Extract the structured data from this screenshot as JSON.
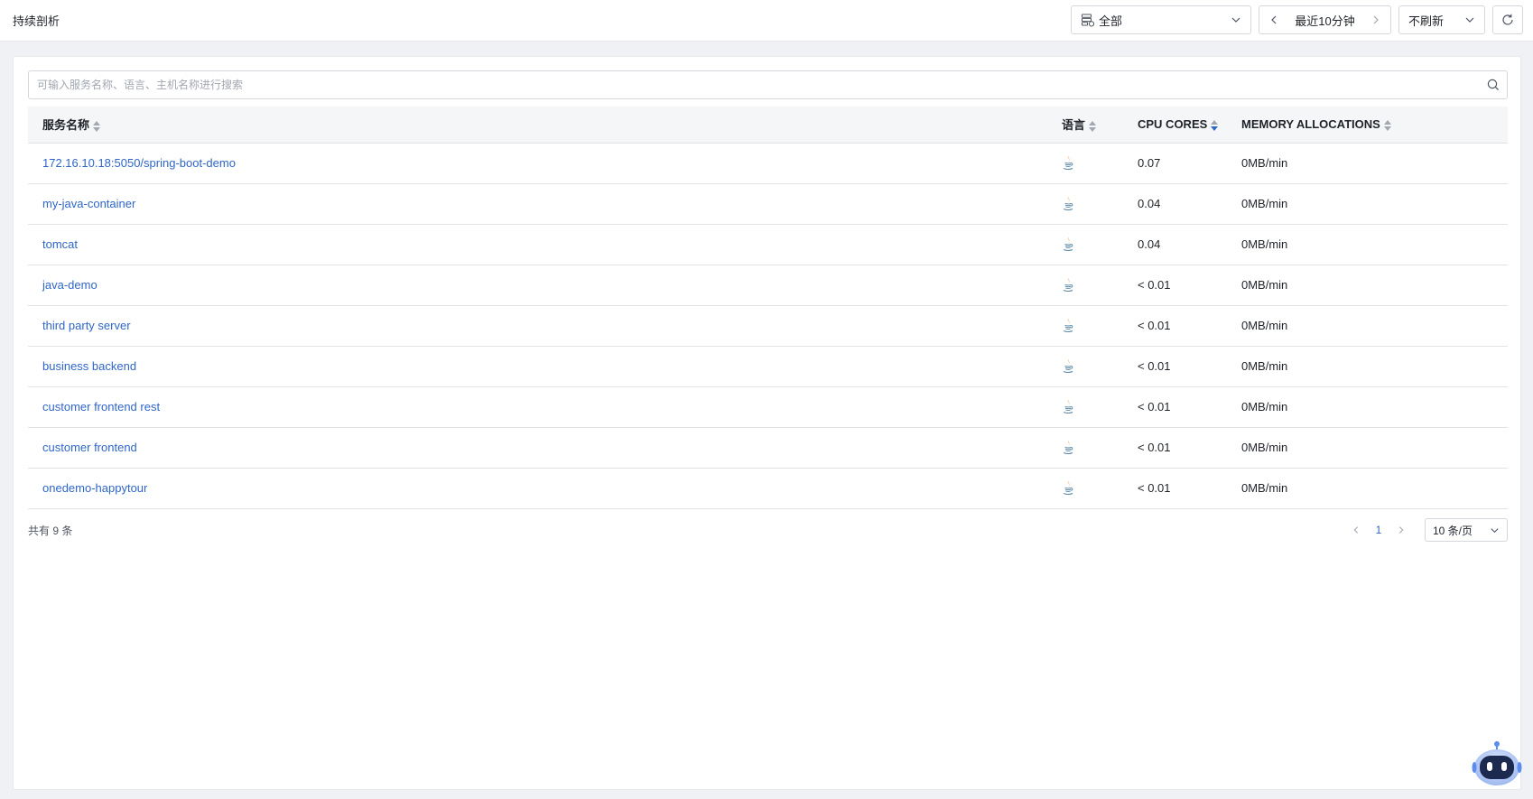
{
  "header": {
    "title": "持续剖析",
    "env_select": {
      "value": "全部",
      "icon": "database-icon"
    },
    "time_range": {
      "value": "最近10分钟"
    },
    "refresh_select": {
      "value": "不刷新"
    },
    "refresh_icon": "refresh-icon"
  },
  "search": {
    "placeholder": "可输入服务名称、语言、主机名称进行搜索",
    "value": ""
  },
  "table": {
    "columns": [
      {
        "label": "服务名称",
        "sort": "none"
      },
      {
        "label": "语言",
        "sort": "none"
      },
      {
        "label": "CPU CORES",
        "sort": "desc"
      },
      {
        "label": "MEMORY ALLOCATIONS",
        "sort": "none"
      }
    ],
    "rows": [
      {
        "name": "172.16.10.18:5050/spring-boot-demo",
        "language": "java",
        "cpu": "0.07",
        "memory": "0MB/min"
      },
      {
        "name": "my-java-container",
        "language": "java",
        "cpu": "0.04",
        "memory": "0MB/min"
      },
      {
        "name": "tomcat",
        "language": "java",
        "cpu": "0.04",
        "memory": "0MB/min"
      },
      {
        "name": "java-demo",
        "language": "java",
        "cpu": "< 0.01",
        "memory": "0MB/min"
      },
      {
        "name": "third party server",
        "language": "java",
        "cpu": "< 0.01",
        "memory": "0MB/min"
      },
      {
        "name": "business backend",
        "language": "java",
        "cpu": "< 0.01",
        "memory": "0MB/min"
      },
      {
        "name": "customer frontend rest",
        "language": "java",
        "cpu": "< 0.01",
        "memory": "0MB/min"
      },
      {
        "name": "customer frontend",
        "language": "java",
        "cpu": "< 0.01",
        "memory": "0MB/min"
      },
      {
        "name": "onedemo-happytour",
        "language": "java",
        "cpu": "< 0.01",
        "memory": "0MB/min"
      }
    ]
  },
  "pagination": {
    "total_text": "共有 9 条",
    "current_page": "1",
    "page_size": "10 条/页"
  },
  "colors": {
    "link": "#2f66c9",
    "sort_active": "#2f66c9"
  },
  "assistant_icon": "robot-assistant-icon"
}
